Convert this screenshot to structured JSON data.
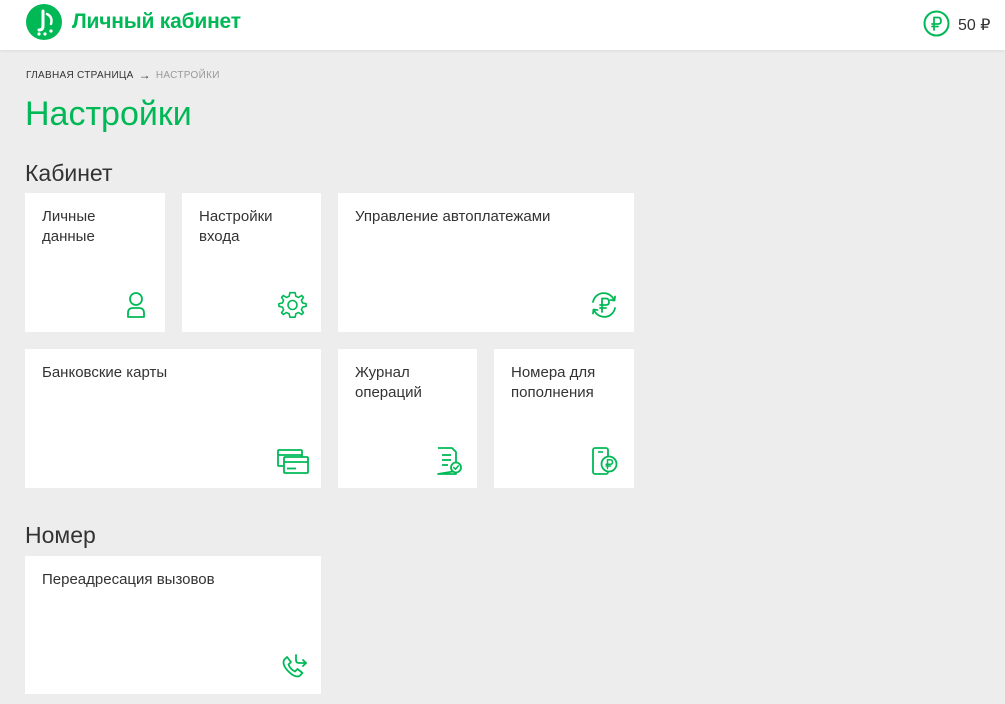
{
  "header": {
    "app_title": "Личный кабинет",
    "balance": "50 ₽",
    "logo_icon": "megafon-logo",
    "balance_icon": "ruble-circle-icon"
  },
  "breadcrumb": {
    "home": "Главная страница",
    "arrow": "→",
    "current": "Настройки"
  },
  "page_title": "Настройки",
  "sections": {
    "cabinet": {
      "title": "Кабинет",
      "tiles": [
        {
          "label": "Личные\nданные",
          "icon": "user-icon"
        },
        {
          "label": "Настройки\nвхода",
          "icon": "gear-icon"
        },
        {
          "label": "Управление автоплатежами",
          "icon": "ruble-refresh-icon"
        },
        {
          "label": "Банковские карты",
          "icon": "bank-card-icon"
        },
        {
          "label": "Журнал\nопераций",
          "icon": "document-check-icon"
        },
        {
          "label": "Номера для\nпополнения",
          "icon": "phone-ruble-icon"
        }
      ]
    },
    "number": {
      "title": "Номер",
      "tiles": [
        {
          "label": "Переадресация вызовов",
          "icon": "phone-forward-icon"
        }
      ]
    }
  },
  "colors": {
    "accent": "#00b956",
    "background": "#ededed",
    "tile": "#ffffff",
    "text": "#333333"
  }
}
